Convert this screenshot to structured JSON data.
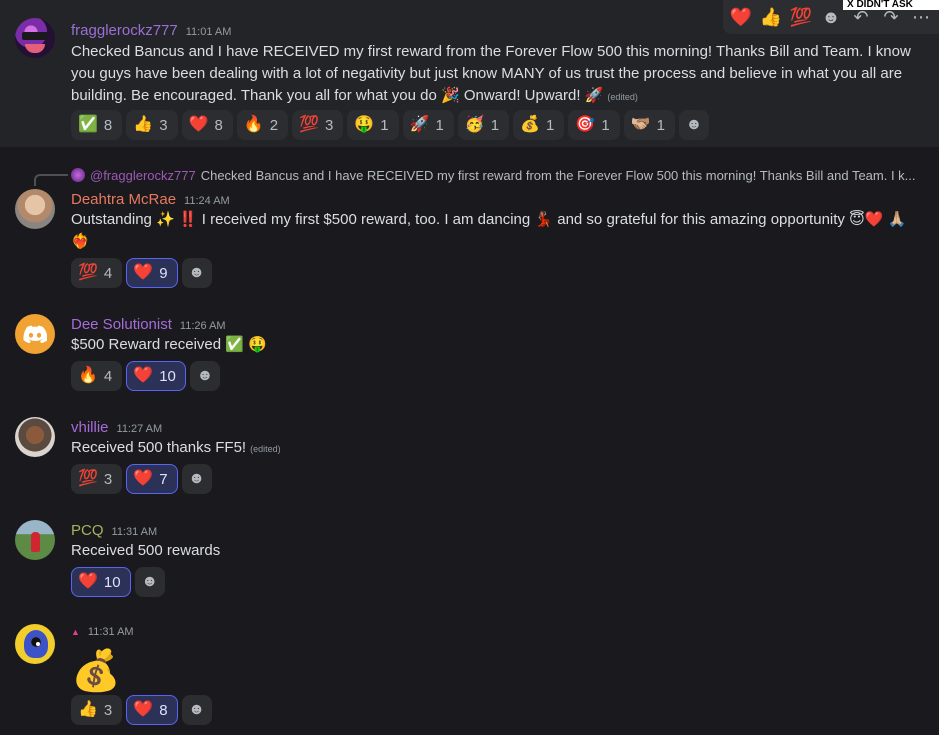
{
  "toolbar": {
    "quick_reactions": [
      "❤️",
      "👍",
      "💯"
    ],
    "banner_text": "X DIDN'T ASK"
  },
  "messages": [
    {
      "username": "fragglerockz777",
      "username_color": "#9b6fd6",
      "time": "11:01 AM",
      "text": "Checked Bancus and I have RECEIVED my first  reward from the Forever Flow 500 this morning! Thanks Bill and Team. I know you guys have been dealing with a lot of negativity but just know MANY of us trust the process and believe in what you all are building. Be encouraged. Thank you all for what you do 🎉 Onward! Upward! 🚀",
      "edited": "(edited)",
      "reactions": [
        {
          "emoji": "✅",
          "count": "8"
        },
        {
          "emoji": "👍",
          "count": "3"
        },
        {
          "emoji": "❤️",
          "count": "8"
        },
        {
          "emoji": "🔥",
          "count": "2"
        },
        {
          "emoji": "💯",
          "count": "3"
        },
        {
          "emoji": "🤑",
          "count": "1"
        },
        {
          "emoji": "🚀",
          "count": "1"
        },
        {
          "emoji": "🥳",
          "count": "1"
        },
        {
          "emoji": "💰",
          "count": "1"
        },
        {
          "emoji": "🎯",
          "count": "1"
        },
        {
          "emoji": "🫱🏼‍🫲🏽",
          "count": "1"
        }
      ]
    },
    {
      "reply_to": {
        "name": "@fragglerockz777",
        "text": "Checked Bancus and I have RECEIVED my first  reward from the Forever Flow 500 this morning! Thanks Bill and Team. I k..."
      },
      "username": "Deahtra McRae",
      "username_color": "#e7795f",
      "time": "11:24 AM",
      "text": "Outstanding ✨ ‼️ I received my first $500 reward, too. I am dancing 💃🏽 and so grateful for this amazing opportunity 😇❤️ 🙏🏼❤️‍🔥",
      "reactions": [
        {
          "emoji": "💯",
          "count": "4"
        },
        {
          "emoji": "❤️",
          "count": "9",
          "me": true
        }
      ]
    },
    {
      "username": "Dee Solutionist",
      "username_color": "#a66bd9",
      "time": "11:26 AM",
      "text": "$500 Reward received ✅ 🤑",
      "reactions": [
        {
          "emoji": "🔥",
          "count": "4"
        },
        {
          "emoji": "❤️",
          "count": "10",
          "me": true
        }
      ]
    },
    {
      "username": "vhillie",
      "username_color": "#a66bd9",
      "time": "11:27 AM",
      "text": "Received 500 thanks FF5!",
      "edited": "(edited)",
      "reactions": [
        {
          "emoji": "💯",
          "count": "3"
        },
        {
          "emoji": "❤️",
          "count": "7",
          "me": true
        }
      ]
    },
    {
      "username": "PCQ",
      "username_color": "#a4b35c",
      "time": "11:31 AM",
      "text": "Received 500 rewards",
      "reactions": [
        {
          "emoji": "❤️",
          "count": "10",
          "me": true
        }
      ]
    },
    {
      "username": "▲",
      "username_color": "#e23d8e",
      "time": "11:31 AM",
      "text": "💰",
      "reactions": [
        {
          "emoji": "👍",
          "count": "3"
        },
        {
          "emoji": "❤️",
          "count": "8",
          "me": true
        }
      ]
    }
  ]
}
